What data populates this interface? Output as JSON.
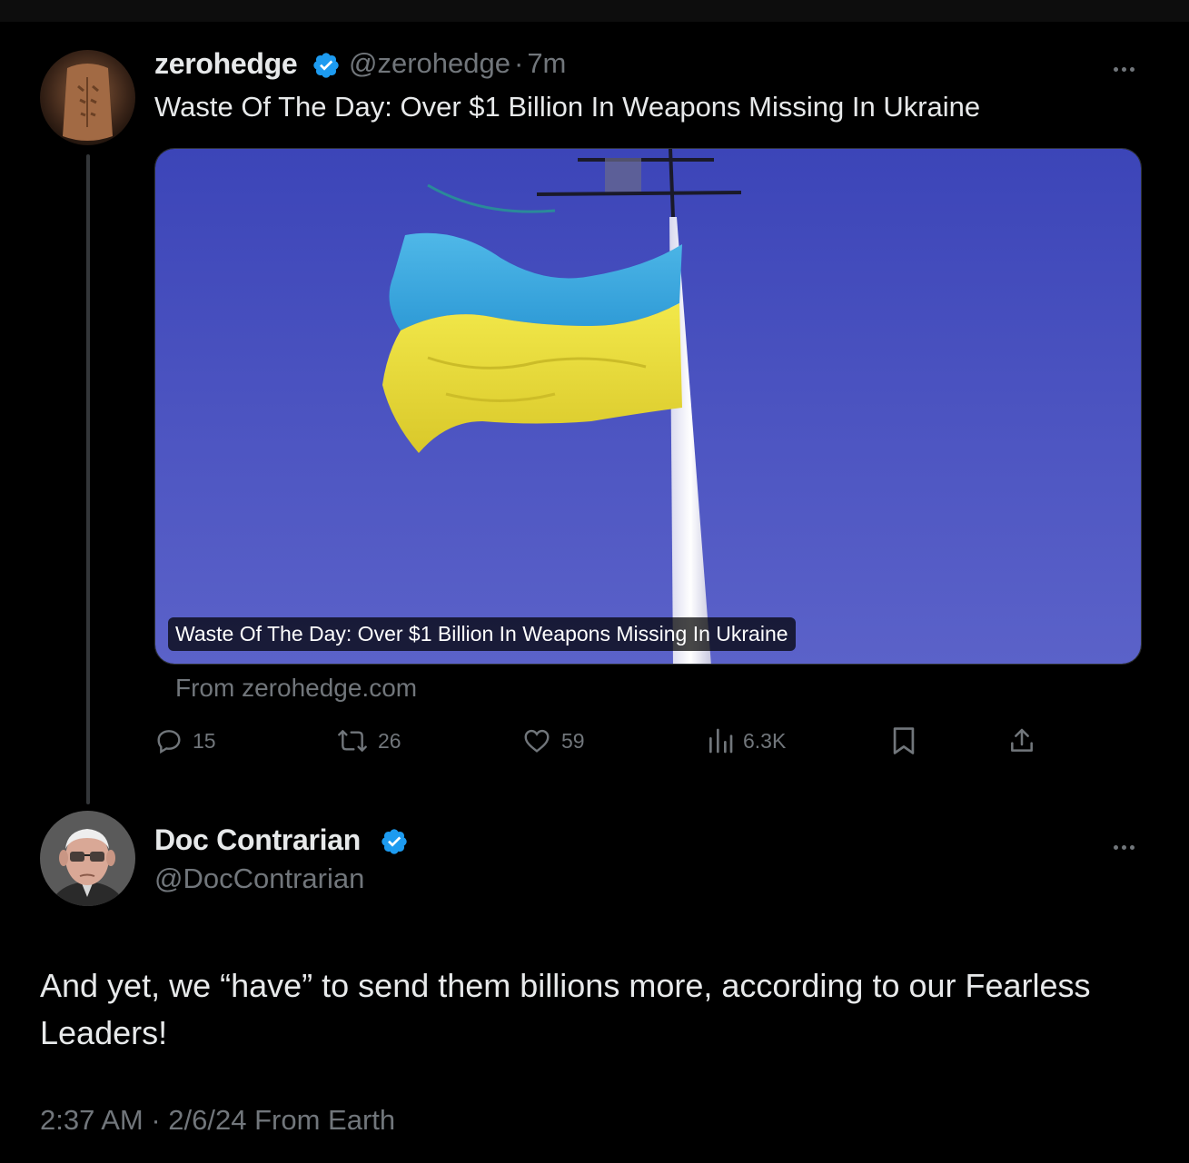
{
  "quoted_tweet": {
    "author_name": "zerohedge",
    "handle": "@zerohedge",
    "time_sep": "·",
    "time": "7m",
    "text": "Waste Of The Day: Over $1 Billion In Weapons Missing In Ukraine",
    "card": {
      "caption": "Waste Of The Day: Over $1 Billion In Weapons Missing In Ukraine",
      "source": "From zerohedge.com"
    },
    "stats": {
      "replies": "15",
      "reposts": "26",
      "likes": "59",
      "views": "6.3K"
    }
  },
  "main_tweet": {
    "author_name": "Doc Contrarian",
    "handle": "@DocContrarian",
    "text": "And yet, we “have” to send them billions more, according to our Fearless Leaders!",
    "meta": "2:37 AM · 2/6/24 From Earth"
  },
  "icons": {
    "verified": "verified-badge-icon",
    "more": "more-dots-icon",
    "reply": "reply-icon",
    "repost": "repost-icon",
    "like": "heart-icon",
    "views": "views-icon",
    "bookmark": "bookmark-icon",
    "share": "share-icon"
  },
  "colors": {
    "background": "#000000",
    "text_primary": "#e7e9ea",
    "text_secondary": "#71767b",
    "verified": "#1d9bf0"
  }
}
